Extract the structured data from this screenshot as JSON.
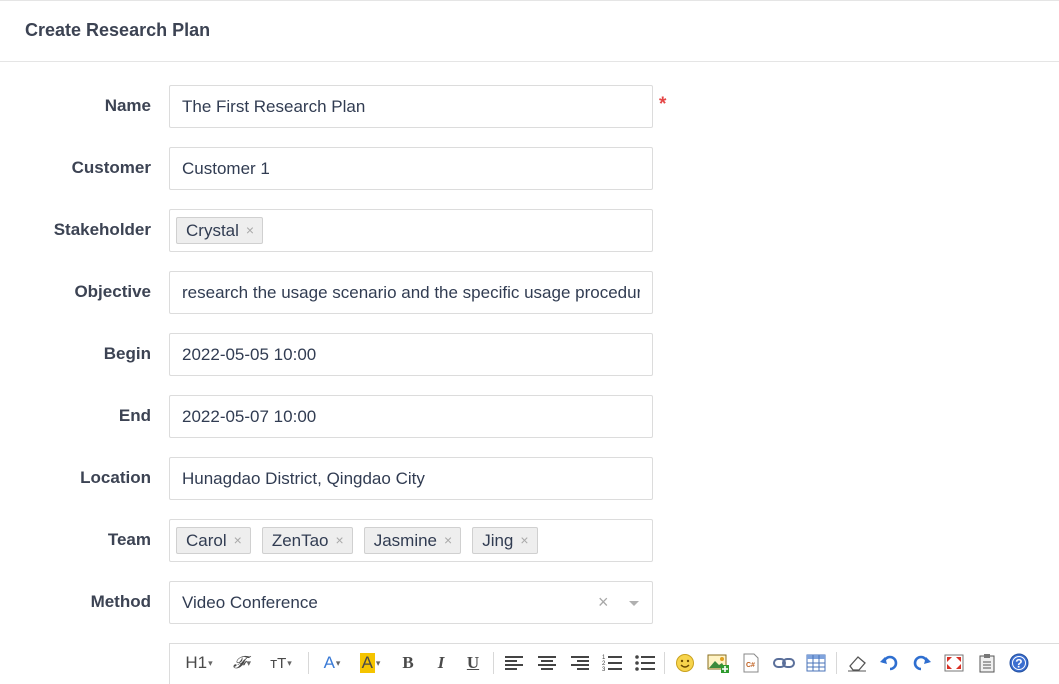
{
  "header": {
    "title": "Create Research Plan"
  },
  "form": {
    "name": {
      "label": "Name",
      "value": "The First Research Plan",
      "required_mark": "*"
    },
    "customer": {
      "label": "Customer",
      "value": "Customer 1"
    },
    "stakeholder": {
      "label": "Stakeholder",
      "chips": [
        "Crystal"
      ]
    },
    "objective": {
      "label": "Objective",
      "value": "research the usage scenario and the specific usage procedure"
    },
    "begin": {
      "label": "Begin",
      "value": "2022-05-05 10:00"
    },
    "end": {
      "label": "End",
      "value": "2022-05-07 10:00"
    },
    "location": {
      "label": "Location",
      "value": "Hunagdao District, Qingdao City"
    },
    "team": {
      "label": "Team",
      "chips": [
        "Carol",
        "ZenTao",
        "Jasmine",
        "Jing"
      ]
    },
    "method": {
      "label": "Method",
      "value": "Video Conference"
    },
    "chip_remove_glyph": "×",
    "clear_glyph": "×"
  },
  "toolbar": {
    "heading_label": "H1",
    "font_family_label": "𝓕",
    "font_size_label": "тT",
    "font_color_label": "A",
    "highlight_label": "A",
    "bold_label": "B",
    "italic_label": "I",
    "underline_label": "U",
    "caret": "▾",
    "colors": {
      "font_color": "#3b7bd6",
      "highlight": "#f5c400",
      "icon_blue": "#2f6fd0"
    }
  }
}
